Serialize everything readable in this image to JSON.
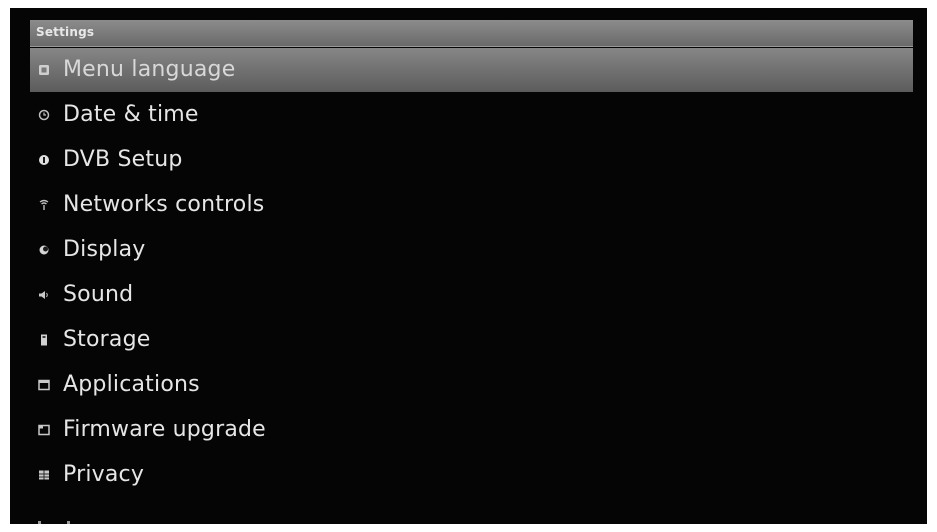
{
  "window": {
    "title": "Settings"
  },
  "menu": {
    "items": [
      {
        "label": "Menu language",
        "icon": "language-icon",
        "selected": true
      },
      {
        "label": "Date & time",
        "icon": "clock-icon",
        "selected": false
      },
      {
        "label": "DVB Setup",
        "icon": "dvb-icon",
        "selected": false
      },
      {
        "label": "Networks controls",
        "icon": "network-icon",
        "selected": false
      },
      {
        "label": "Display",
        "icon": "display-icon",
        "selected": false
      },
      {
        "label": "Sound",
        "icon": "speaker-icon",
        "selected": false
      },
      {
        "label": "Storage",
        "icon": "storage-icon",
        "selected": false
      },
      {
        "label": "Applications",
        "icon": "applications-icon",
        "selected": false
      },
      {
        "label": "Firmware upgrade",
        "icon": "firmware-icon",
        "selected": false
      },
      {
        "label": "Privacy",
        "icon": "privacy-icon",
        "selected": false
      }
    ]
  },
  "colors": {
    "background": "#050505",
    "highlight": "#787878",
    "text": "#e6e6e6"
  }
}
